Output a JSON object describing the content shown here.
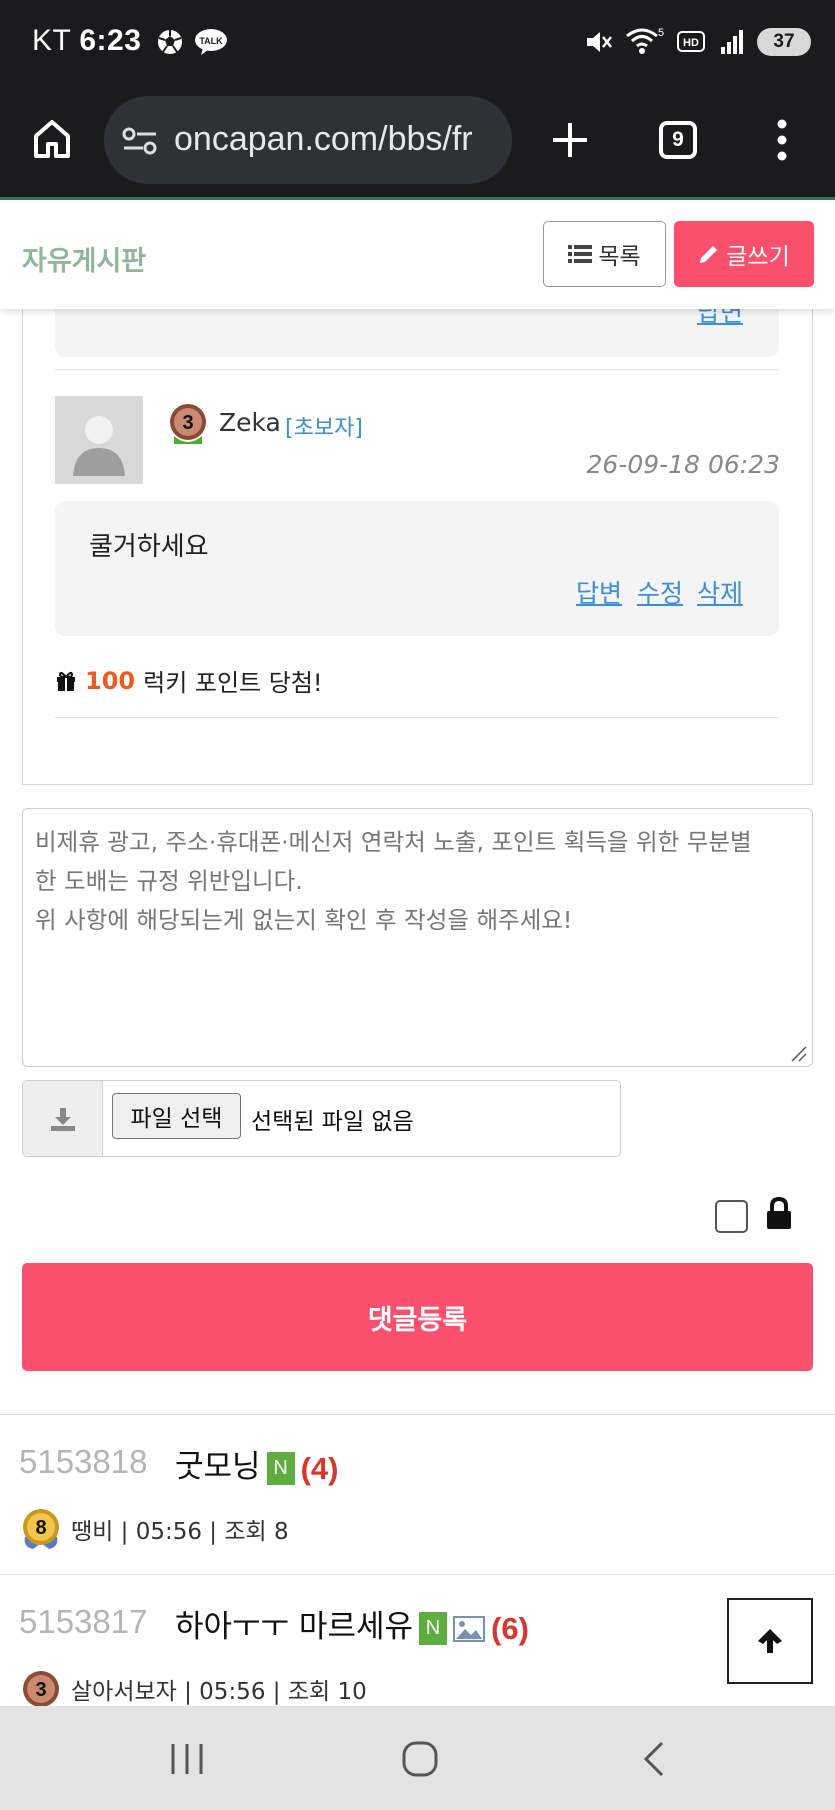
{
  "status_bar": {
    "carrier": "KT",
    "time": "6:23",
    "battery": "37",
    "wifi_label": "5",
    "hd_label": "HD"
  },
  "browser": {
    "url": "oncapan.com/bbs/fr",
    "tab_count": "9"
  },
  "board": {
    "title": "자유게시판",
    "list_button": "목록",
    "write_button": "글쓰기"
  },
  "previous_comment": {
    "reply_link": "답변"
  },
  "comment": {
    "level": "3",
    "author": "Zeka",
    "grade": "[초보자]",
    "date": "26-09-18 06:23",
    "text": "쿨거하세요",
    "actions": [
      "답변",
      "수정",
      "삭제"
    ],
    "lucky_points": "100",
    "lucky_text": "럭키 포인트 당첨!"
  },
  "comment_form": {
    "placeholder": "비제휴 광고, 주소·휴대폰·메신저 연락처 노출, 포인트 획득을 위한 무분별\n한 도배는 규정 위반입니다.\n위 사항에 해당되는게 없는지 확인 후 작성을 해주세요!",
    "file_button": "파일 선택",
    "file_status": "선택된 파일 없음",
    "submit_label": "댓글등록"
  },
  "posts": [
    {
      "number": "5153818",
      "title": "굿모닝",
      "new_badge": "N",
      "has_image": false,
      "comment_count": "(4)",
      "level": "8",
      "meta": "땡비 | 05:56 | 조회 8"
    },
    {
      "number": "5153817",
      "title": "하아ㅜㅜ 마르세유",
      "new_badge": "N",
      "has_image": true,
      "comment_count": "(6)",
      "level": "3",
      "meta": "살아서보자 | 05:56 | 조회 10"
    }
  ],
  "colors": {
    "accent": "#fb4f6e",
    "board_title": "#8fb79a",
    "link": "#3b8fd6",
    "comment_count": "#d8352b",
    "new_badge": "#5dae3f",
    "lucky_points": "#e95b21"
  }
}
